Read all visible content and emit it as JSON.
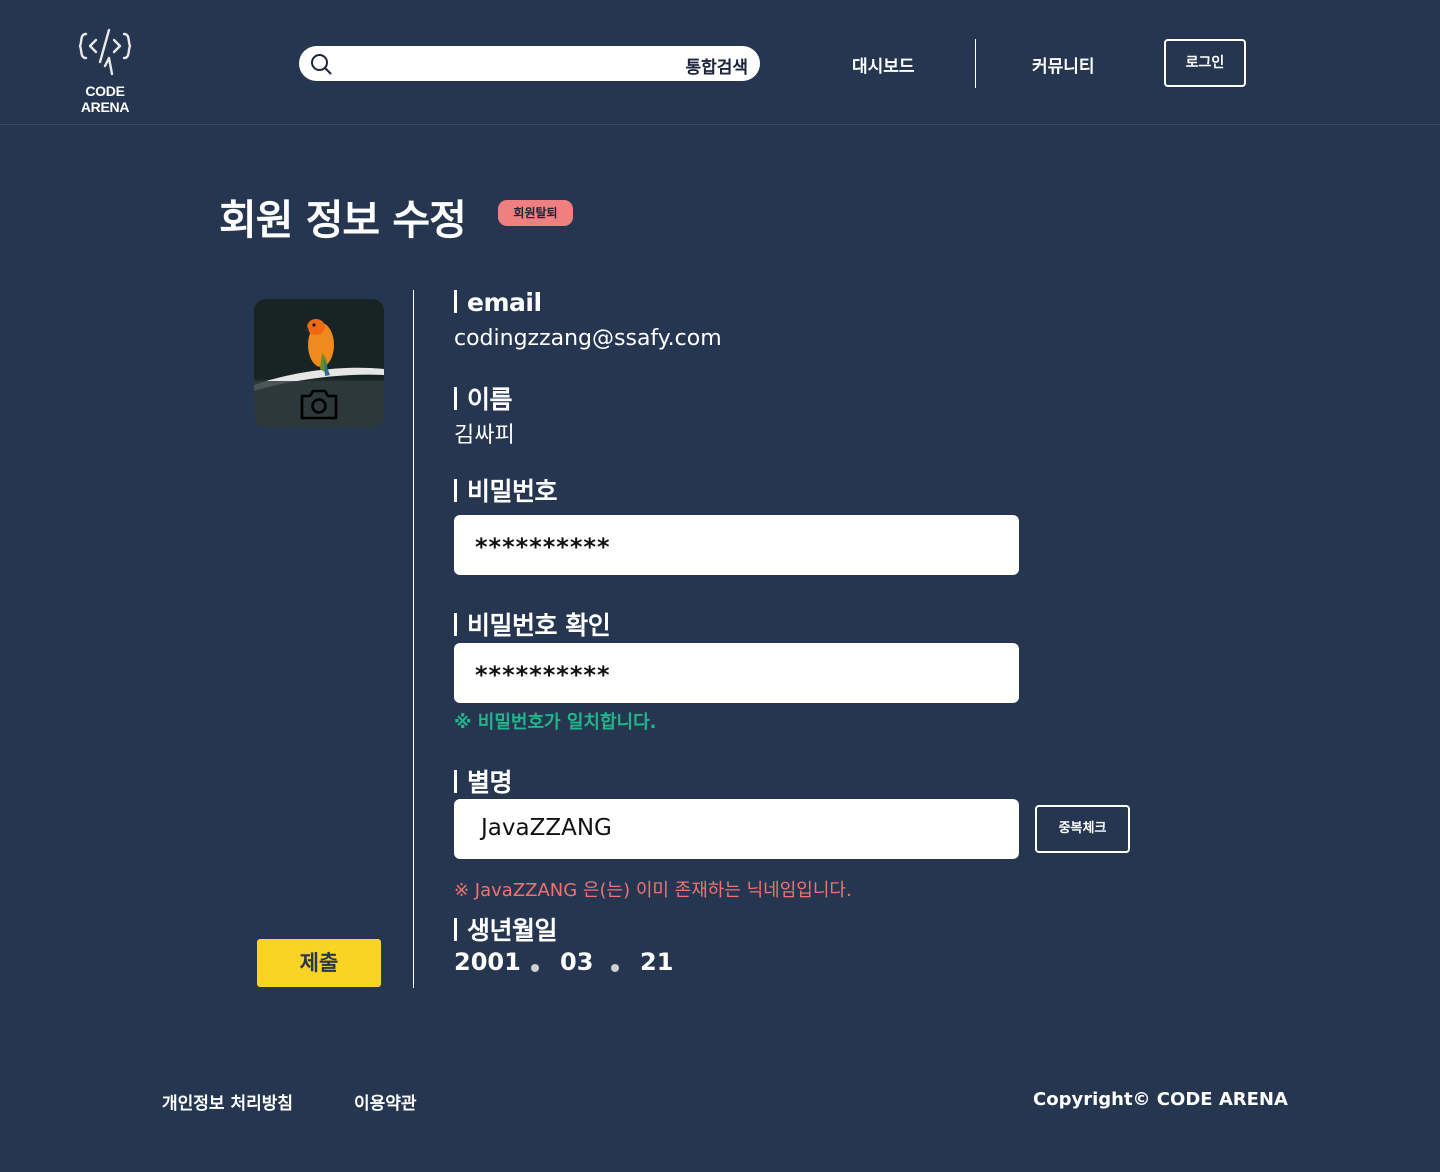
{
  "header": {
    "logo_text": "CODE ARENA",
    "search": {
      "label": "통합검색",
      "value": ""
    },
    "nav": {
      "dashboard": "대시보드",
      "community": "커뮤니티",
      "login": "로그인"
    }
  },
  "page": {
    "title": "회원 정보 수정",
    "withdraw_badge": "회원탈퇴",
    "submit_label": "제출"
  },
  "form": {
    "email": {
      "label": "email",
      "value": "codingzzang@ssafy.com"
    },
    "name": {
      "label": "이름",
      "value": "김싸피"
    },
    "password": {
      "label": "비밀번호",
      "value": "**********"
    },
    "password_confirm": {
      "label": "비밀번호 확인",
      "value": "**********",
      "message": "※ 비밀번호가 일치합니다."
    },
    "nickname": {
      "label": "별명",
      "value": "JavaZZANG",
      "check_button": "중복체크",
      "message": "※ JavaZZANG 은(는) 이미 존재하는 닉네임입니다."
    },
    "birth": {
      "label": "생년월일",
      "year": "2001",
      "month": "03",
      "day": "21"
    }
  },
  "footer": {
    "privacy": "개인정보 처리방침",
    "terms": "이용약관",
    "copyright": "Copyright© CODE ARENA"
  },
  "colors": {
    "background": "#263650",
    "accent_yellow": "#fad424",
    "badge_red": "#f08080",
    "success_green": "#22b58a",
    "error_red": "#f07272"
  },
  "icons": [
    "code-logo-icon",
    "search-icon",
    "camera-icon"
  ]
}
